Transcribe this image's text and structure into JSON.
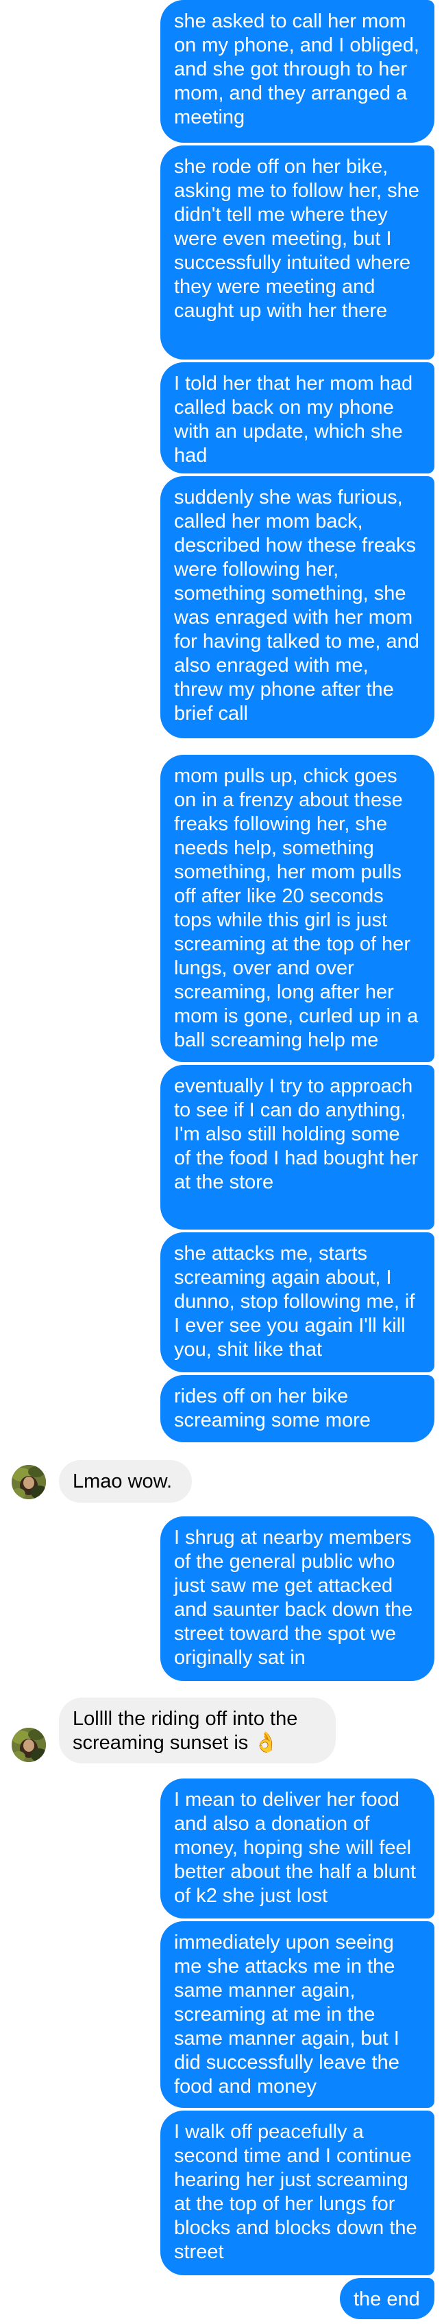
{
  "messages": [
    {
      "from": "me",
      "text": "she asked to call her mom on my phone, and I obliged, and she got through to her mom, and they arranged a meeting"
    },
    {
      "from": "me",
      "text": "she rode off on her bike, asking me to follow her, she didn't tell me where they were even meeting, but I successfully intuited where they were meeting and caught up with her there"
    },
    {
      "from": "me",
      "text": "I told her that her mom had called back on my phone with an update, which she had"
    },
    {
      "from": "me",
      "text": "suddenly she was furious, called her mom back, described how these freaks were following her, something something, she was enraged with her mom for having talked to me, and also enraged with me, threw my phone after the brief call"
    },
    {
      "from": "me",
      "text": "mom pulls up, chick goes on in a frenzy about these freaks following her, she needs help, something something, her mom pulls off after like 20 seconds tops while this girl is just screaming at the top of her lungs, over and over screaming, long after her mom is gone, curled up in a ball screaming help me"
    },
    {
      "from": "me",
      "text": "eventually I try to approach to see if I can do anything, I'm also still holding some of the food I had bought her at the store"
    },
    {
      "from": "me",
      "text": "she attacks me, starts screaming again about, I dunno, stop following me, if I ever see you again I'll kill you, shit like that"
    },
    {
      "from": "me",
      "text": "rides off on her bike screaming some more"
    },
    {
      "from": "them",
      "text": "Lmao wow."
    },
    {
      "from": "me",
      "text": "I shrug at nearby members of the general public who just saw me get attacked and saunter back down the street toward the spot we originally sat in"
    },
    {
      "from": "them",
      "text": "Lollll the riding off into the screaming sunset is 👌"
    },
    {
      "from": "me",
      "text": "I mean to deliver her food and also a donation of money, hoping she will feel better about the half a blunt of k2 she just lost"
    },
    {
      "from": "me",
      "text": "immediately upon seeing me she attacks me in the same manner again, screaming at me in the same manner again, but I did successfully leave the food and money"
    },
    {
      "from": "me",
      "text": "I walk off peacefully a second time and I continue hearing her just screaming at the top of her lungs for blocks and blocks down the street"
    },
    {
      "from": "me",
      "text": "the end"
    }
  ],
  "contact_avatar": {
    "icon": "avatar-photo-icon"
  },
  "colors": {
    "outgoing": "#0a84ff",
    "incoming": "#f1f0f0"
  }
}
